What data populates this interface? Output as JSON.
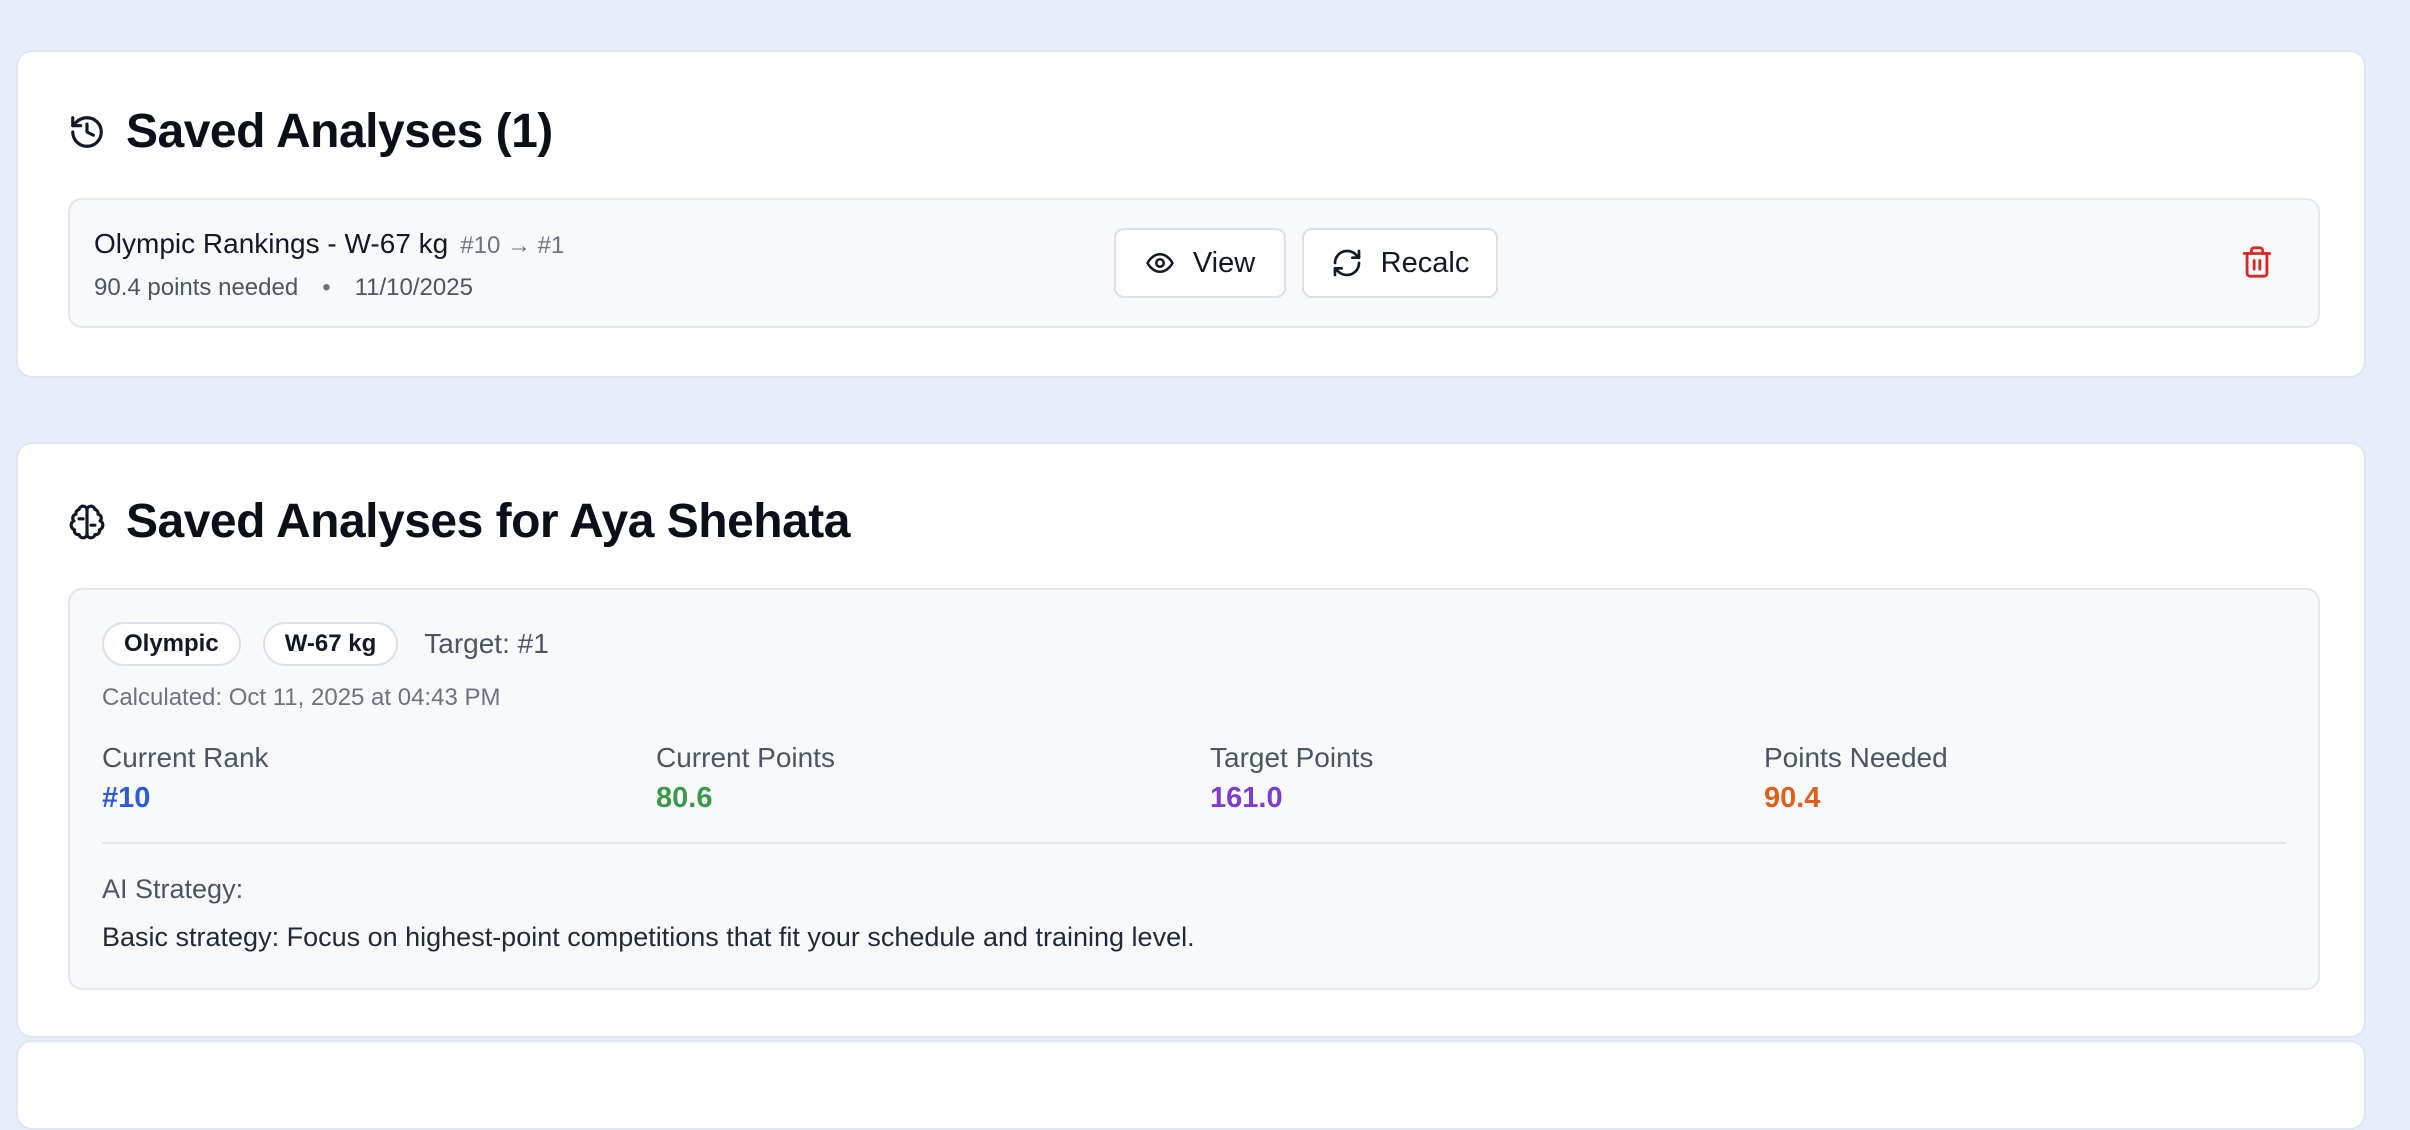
{
  "saved_section": {
    "title": "Saved Analyses (1)",
    "item": {
      "name": "Olympic Rankings - W-67 kg",
      "rank_change": "#10 → #1",
      "points_needed": "90.4 points needed",
      "separator": "•",
      "date": "11/10/2025",
      "view_label": "View",
      "recalc_label": "Recalc"
    }
  },
  "athlete_section": {
    "title": "Saved Analyses for Aya Shehata",
    "analysis": {
      "badges": [
        "Olympic",
        "W-67 kg"
      ],
      "target": "Target: #1",
      "calculated": "Calculated: Oct 11, 2025 at 04:43 PM",
      "stats": [
        {
          "label": "Current Rank",
          "value": "#10",
          "color": "#2f5ad6"
        },
        {
          "label": "Current Points",
          "value": "80.6",
          "color": "#3b9a4a"
        },
        {
          "label": "Target Points",
          "value": "161.0",
          "color": "#7e3bd6"
        },
        {
          "label": "Points Needed",
          "value": "90.4",
          "color": "#dd5f1e"
        }
      ],
      "ai_label": "AI Strategy:",
      "ai_text": "Basic strategy: Focus on highest-point competitions that fit your schedule and training level."
    }
  },
  "colors": {
    "background": "#e7edfb",
    "delete": "#dc2626"
  },
  "icons": {
    "history": "history-icon",
    "brain": "brain-icon",
    "eye": "eye-icon",
    "refresh": "refresh-icon",
    "trash": "trash-icon"
  }
}
